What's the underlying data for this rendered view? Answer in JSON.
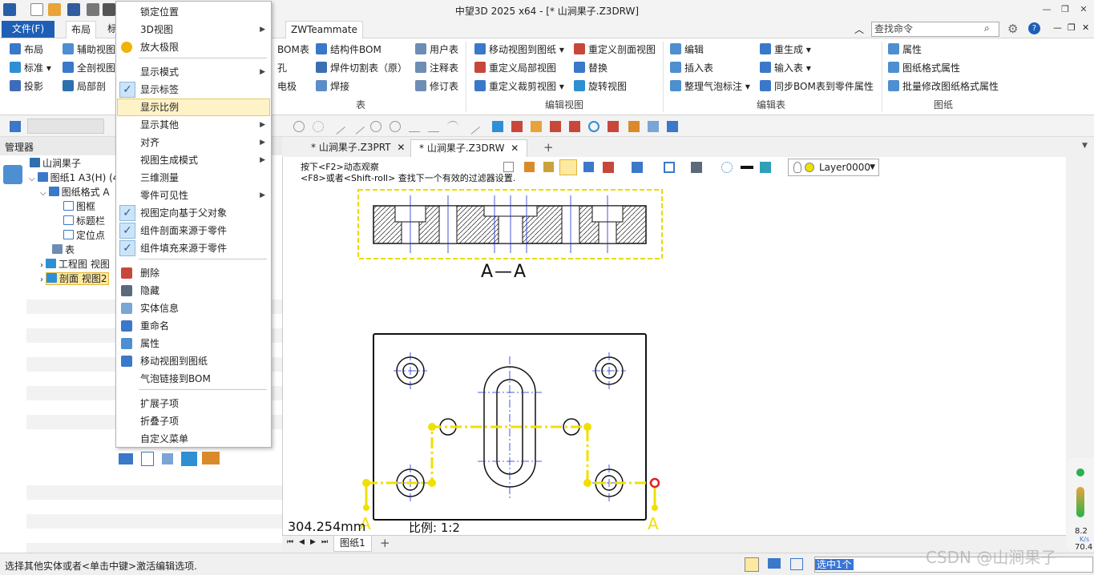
{
  "titlebar": {
    "title": "中望3D 2025 x64 - [* 山涧果子.Z3DRW]"
  },
  "tabs": {
    "file": "文件(F)",
    "items": [
      "布局",
      "标"
    ],
    "extra": "ZWTeammate"
  },
  "search": {
    "placeholder": "查找命令"
  },
  "ribbon": {
    "layout_col1": [
      "布局",
      "标准",
      "投影"
    ],
    "layout_col2": [
      "辅助视图",
      "全剖视图",
      "局部剖"
    ],
    "table_col1": [
      "BOM表",
      "孔",
      "电极"
    ],
    "table_col2": [
      "结构件BOM",
      "焊件切割表（原）",
      "焊接"
    ],
    "table_col3": [
      "用户表",
      "注释表",
      "修订表"
    ],
    "table_group": "表",
    "editview_col1": [
      "移动视图到图纸",
      "重定义局部视图",
      "重定义裁剪视图"
    ],
    "editview_col2": [
      "重定义剖面视图",
      "替换",
      "旋转视图"
    ],
    "editview_group": "编辑视图",
    "edittable_col1": [
      "编辑",
      "插入表",
      "整理气泡标注"
    ],
    "edittable_col2": [
      "重生成",
      "输入表",
      "同步BOM表到零件属性"
    ],
    "edittable_group": "编辑表",
    "sheet_col": [
      "属性",
      "图纸格式属性",
      "批量修改图纸格式属性"
    ],
    "sheet_group": "图纸"
  },
  "manager": {
    "title": "管理器",
    "tree": [
      "山涧果子",
      "图纸1 A3(H) (4",
      "图纸格式 A",
      "图框",
      "标题栏",
      "定位点",
      "表",
      "工程图 视图",
      "剖面 视图2"
    ]
  },
  "context_menu": {
    "items": [
      {
        "label": "锁定位置"
      },
      {
        "label": "3D视图",
        "sub": true
      },
      {
        "label": "放大极限"
      },
      {
        "label": "显示模式",
        "sub": true
      },
      {
        "label": "显示标签",
        "checked": true
      },
      {
        "label": "显示比例",
        "highlight": true
      },
      {
        "label": "显示其他",
        "sub": true
      },
      {
        "label": "对齐",
        "sub": true
      },
      {
        "label": "视图生成模式",
        "sub": true
      },
      {
        "label": "三维测量"
      },
      {
        "label": "零件可见性",
        "sub": true
      },
      {
        "label": "视图定向基于父对象",
        "checked": true
      },
      {
        "label": "组件剖面来源于零件",
        "checked": true
      },
      {
        "label": "组件填充来源于零件",
        "checked": true
      },
      {
        "label": "删除"
      },
      {
        "label": "隐藏"
      },
      {
        "label": "实体信息"
      },
      {
        "label": "重命名"
      },
      {
        "label": "属性"
      },
      {
        "label": "移动视图到图纸"
      },
      {
        "label": "气泡链接到BOM"
      },
      {
        "label": "扩展子项"
      },
      {
        "label": "折叠子项"
      },
      {
        "label": "自定义菜单"
      }
    ]
  },
  "doc_tabs": [
    "* 山涧果子.Z3PRT",
    "* 山涧果子.Z3DRW"
  ],
  "hints": {
    "line1": "按下<F2>动态观察",
    "line2": "<F8>或者<Shift-roll> 查找下一个有效的过滤器设置."
  },
  "layer": "Layer0000",
  "drawing": {
    "section_label": "A—A",
    "cut_label_left": "A",
    "cut_label_right": "A",
    "dimension": "304.254mm",
    "scale": "比例:   1:2"
  },
  "sheet_tab": "图纸1",
  "status": {
    "message": "选择其他实体或者<单击中键>激活编辑选项.",
    "selection": "选中1个"
  },
  "right_panel": {
    "speed": "8.2",
    "unit": "K/s",
    "value2": "70.4"
  },
  "watermark": "CSDN @山涧果子",
  "colors": {
    "accent": "#1e5fb5",
    "highlight": "#fdf3c6",
    "selection_yellow": "#f0e000",
    "drawing_blue": "#1a2fd0"
  }
}
